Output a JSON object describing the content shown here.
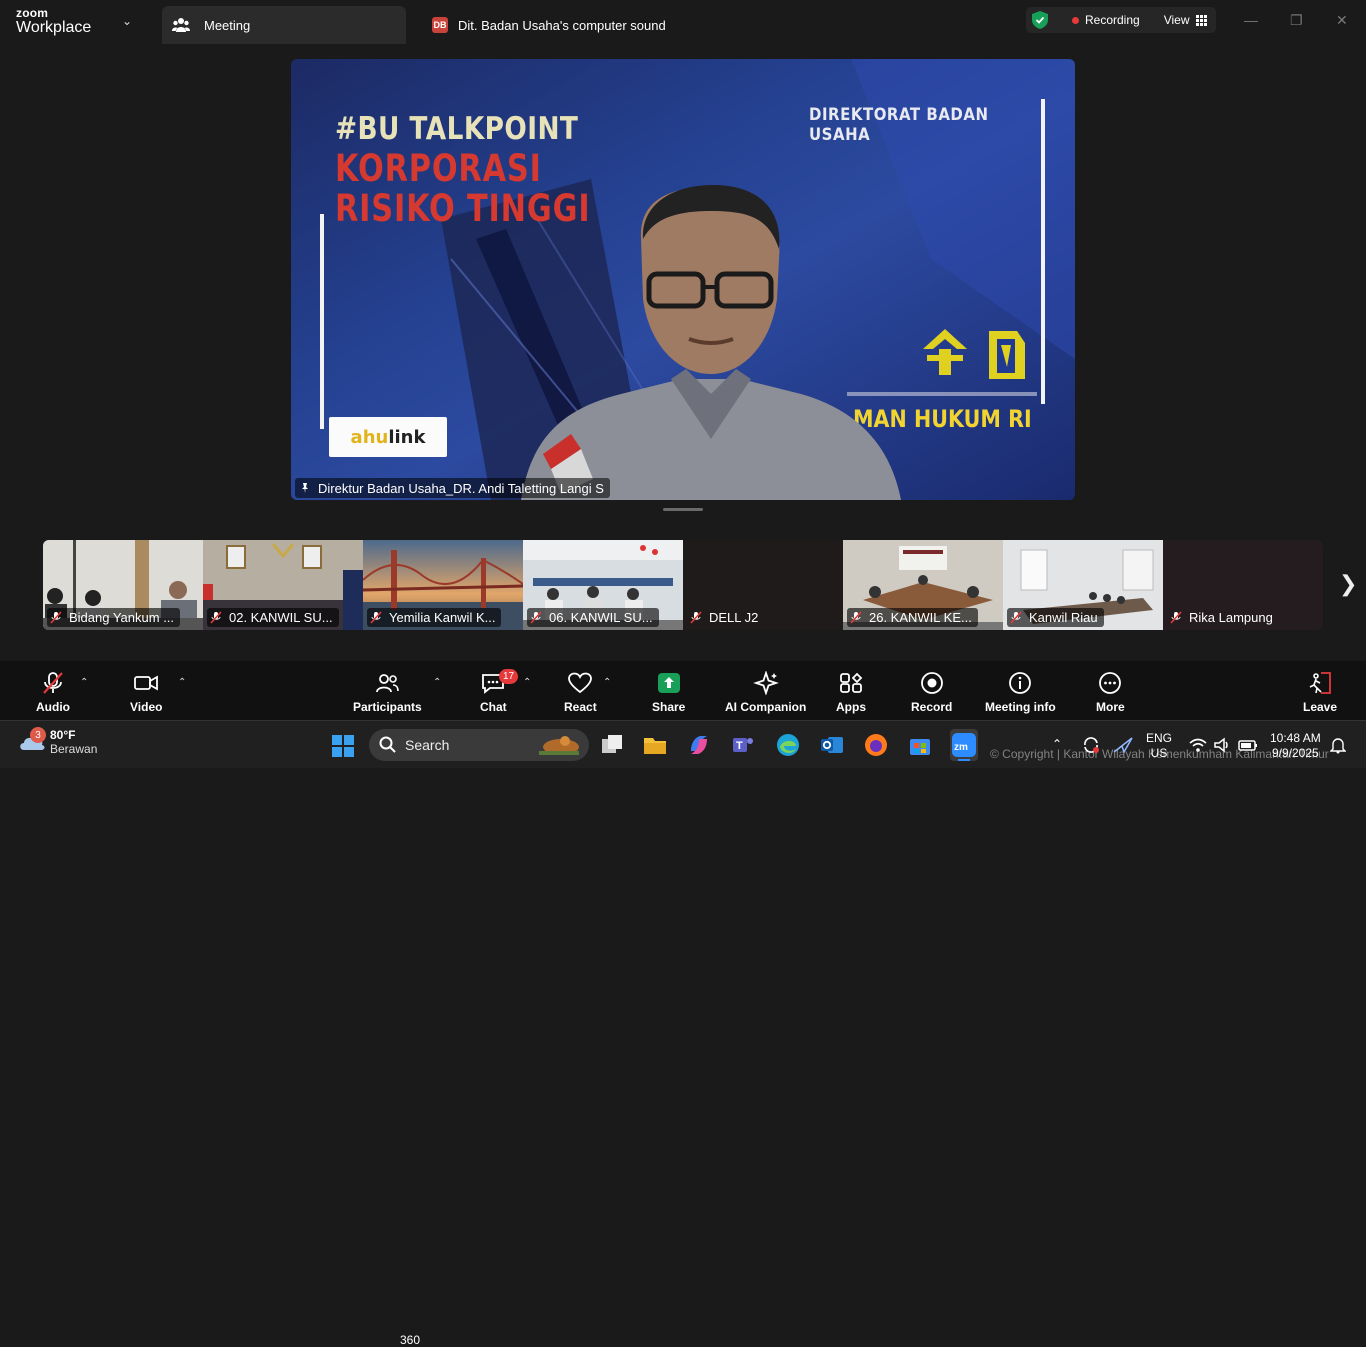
{
  "titlebar": {
    "brand_top": "zoom",
    "brand_bottom": "Workplace",
    "tab_meeting": "Meeting",
    "tab_sound_badge": "DB",
    "tab_sound": "Dit. Badan Usaha's computer sound",
    "recording": "Recording",
    "view": "View"
  },
  "main_video": {
    "slide_tag": "#BU TALKPOINT",
    "slide_line1": "KORPORASI",
    "slide_line2": "RISIKO TINGGI",
    "slide_org": "DIREKTORAT BADAN USAHA",
    "slide_footer": "MAN HUKUM RI",
    "logo_left": "ahu",
    "logo_right": "link",
    "speaker_name": "Direktur Badan Usaha_DR. Andi Taletting Langi S"
  },
  "gallery": [
    {
      "name": "Bidang Yankum ..."
    },
    {
      "name": "02. KANWIL SU..."
    },
    {
      "name": "Yemilia Kanwil K..."
    },
    {
      "name": "06. KANWIL SU..."
    },
    {
      "name": "DELL J2"
    },
    {
      "name": "26. KANWIL KE..."
    },
    {
      "name": "Kanwil Riau"
    },
    {
      "name": "Rika Lampung"
    }
  ],
  "toolbar": {
    "audio": "Audio",
    "video": "Video",
    "participants": "Participants",
    "participant_count": "360",
    "chat": "Chat",
    "chat_badge": "17",
    "react": "React",
    "share": "Share",
    "ai_companion": "AI Companion",
    "apps": "Apps",
    "record": "Record",
    "meeting_info": "Meeting info",
    "more": "More",
    "leave": "Leave"
  },
  "taskbar": {
    "weather_badge": "3",
    "weather_temp": "80°F",
    "weather_desc": "Berawan",
    "search": "Search",
    "lang_top": "ENG",
    "lang_bottom": "US",
    "time": "10:48 AM",
    "date": "9/9/2025",
    "copyright": "© Copyright | Kantor Wilayah Kemenkumham Kalimantan Timur"
  },
  "colors": {
    "accent_green": "#18a058",
    "recording_red": "#e5393b",
    "leave_red": "#e5393b",
    "slide_red": "#d6392f"
  }
}
